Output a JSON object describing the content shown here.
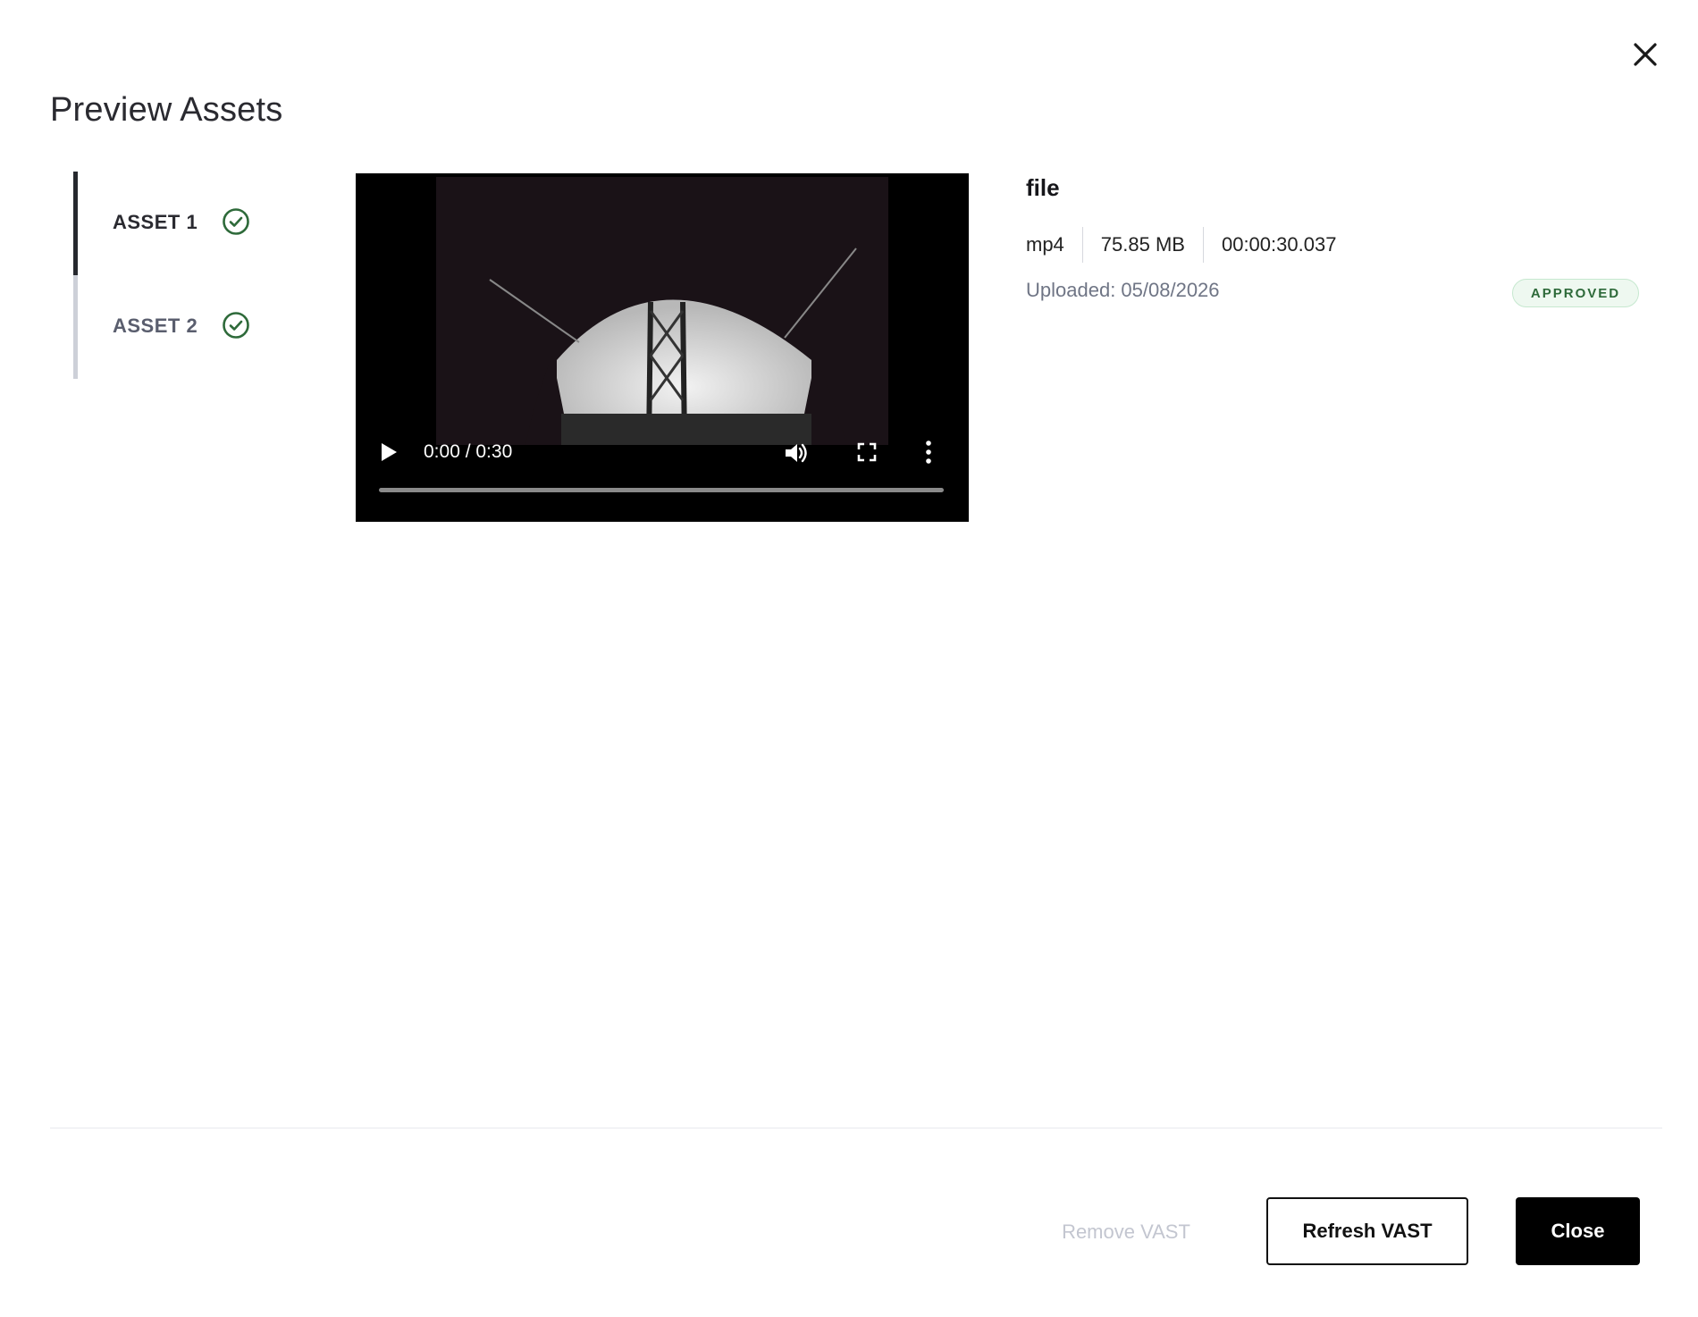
{
  "dialog": {
    "title": "Preview Assets"
  },
  "tabs": [
    {
      "label": "ASSET 1",
      "status": "approved",
      "active": true
    },
    {
      "label": "ASSET 2",
      "status": "approved",
      "active": false
    }
  ],
  "video": {
    "time_display": "0:00 / 0:30",
    "progress": 0
  },
  "file": {
    "name": "file",
    "format": "mp4",
    "size": "75.85 MB",
    "duration": "00:00:30.037",
    "uploaded": "Uploaded: 05/08/2026",
    "status_badge": "APPROVED"
  },
  "footer": {
    "remove_label": "Remove VAST",
    "refresh_label": "Refresh VAST",
    "close_label": "Close"
  },
  "colors": {
    "accent_green": "#2e6a3a",
    "badge_bg": "#eef8f0",
    "primary_button": "#000000",
    "disabled_text": "#c3c6d0"
  }
}
